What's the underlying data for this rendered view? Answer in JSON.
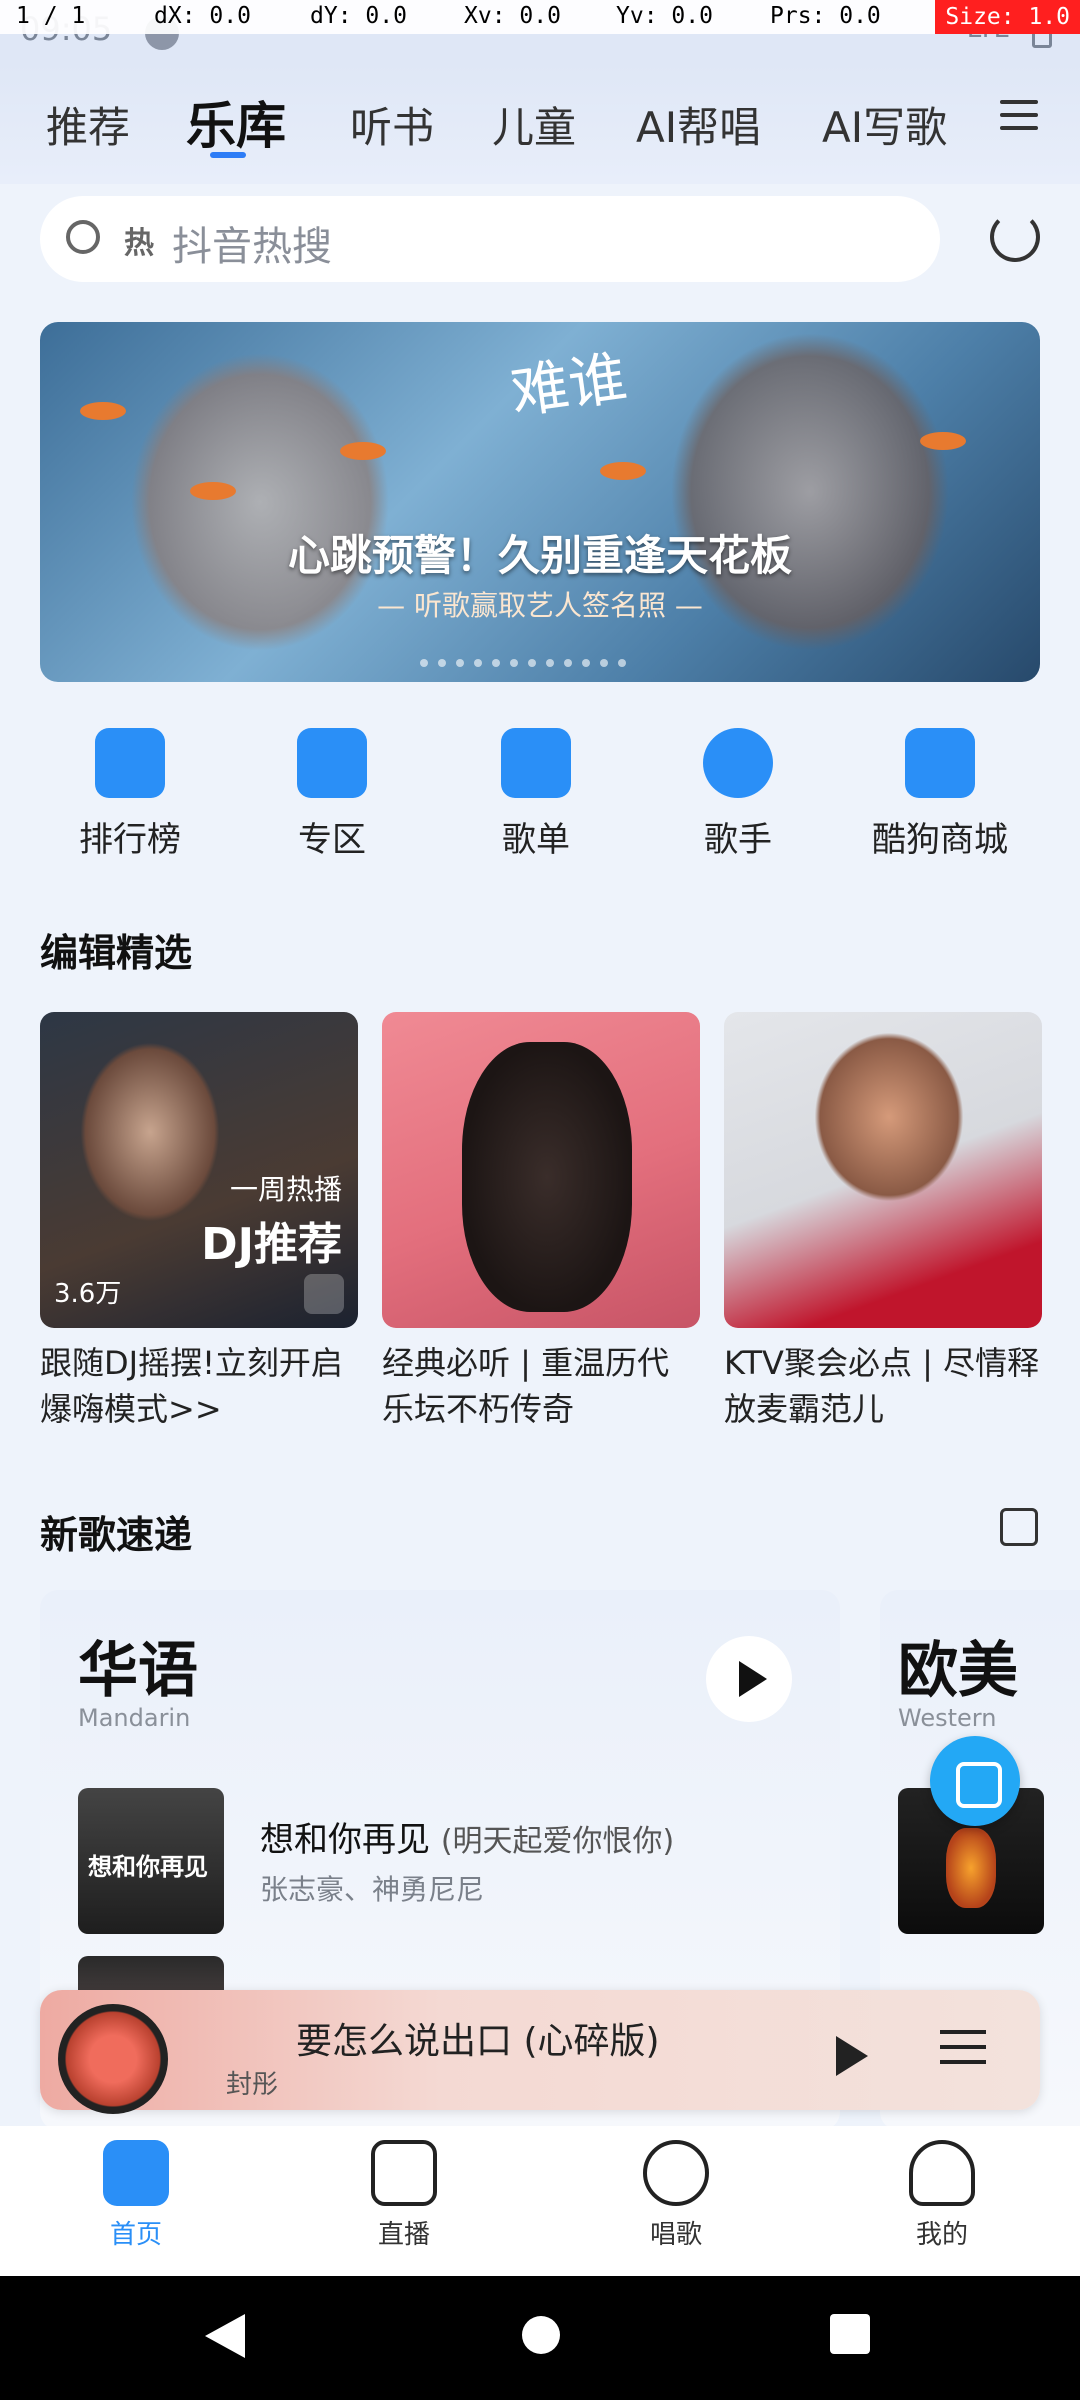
{
  "debug": {
    "pointer": "1 / 1",
    "dx": "dX: 0.0",
    "dy": "dY: 0.0",
    "xv": "Xv: 0.0",
    "yv": "Yv: 0.0",
    "prs": "Prs: 0.0",
    "size": "Size: 1.0"
  },
  "status": {
    "time": "09:05",
    "network": "LTE"
  },
  "tabs": [
    {
      "label": "推荐",
      "active": false
    },
    {
      "label": "乐库",
      "active": true
    },
    {
      "label": "听书",
      "active": false
    },
    {
      "label": "儿童",
      "active": false
    },
    {
      "label": "AI帮唱",
      "active": false
    },
    {
      "label": "AI写歌",
      "active": false
    }
  ],
  "search": {
    "hot_badge": "热",
    "placeholder": "抖音热搜"
  },
  "banner": {
    "logo": "难谁",
    "headline": "心跳预警！久别重逢天花板",
    "subline": "— 听歌赢取艺人签名照 —"
  },
  "shortcuts": [
    {
      "label": "排行榜",
      "icon": "trophy-icon",
      "color": "#2a8ff7"
    },
    {
      "label": "专区",
      "icon": "grid-icon",
      "color": "#2a8ff7"
    },
    {
      "label": "歌单",
      "icon": "playlist-icon",
      "color": "#2a8ff7"
    },
    {
      "label": "歌手",
      "icon": "singer-icon",
      "color": "#2a8ff7"
    },
    {
      "label": "酷狗商城",
      "icon": "kugou-mall-icon",
      "color": "#2a8ff7"
    }
  ],
  "editor_picks": {
    "title": "编辑精选",
    "cards": [
      {
        "tag_small": "一周热播",
        "tag_big": "DJ推荐",
        "plays": "3.6万",
        "title": "跟随DJ摇摆!立刻开启爆嗨模式>>"
      },
      {
        "title": "经典必听 | 重温历代乐坛不朽传奇"
      },
      {
        "title": "KTV聚会必点 | 尽情释放麦霸范儿"
      }
    ]
  },
  "new_songs": {
    "title": "新歌速递",
    "mandarin": {
      "label": "华语",
      "sublabel": "Mandarin"
    },
    "western": {
      "label": "欧美",
      "sublabel": "Western"
    },
    "song1": {
      "cover_text": "想和你再见",
      "title": "想和你再见",
      "subtitle": "(明天起爱你恨你)",
      "artist": "张志豪、神勇尼尼"
    }
  },
  "mini_player": {
    "title": "要怎么说出口 (心碎版)",
    "subtitle": "封彤"
  },
  "bottom_nav": [
    {
      "label": "首页",
      "icon": "home-icon",
      "active": true
    },
    {
      "label": "直播",
      "icon": "live-icon",
      "active": false
    },
    {
      "label": "唱歌",
      "icon": "sing-icon",
      "active": false
    },
    {
      "label": "我的",
      "icon": "profile-icon",
      "active": false
    }
  ],
  "colors": {
    "accent": "#2a8ff7",
    "background": "#eef3fb"
  }
}
